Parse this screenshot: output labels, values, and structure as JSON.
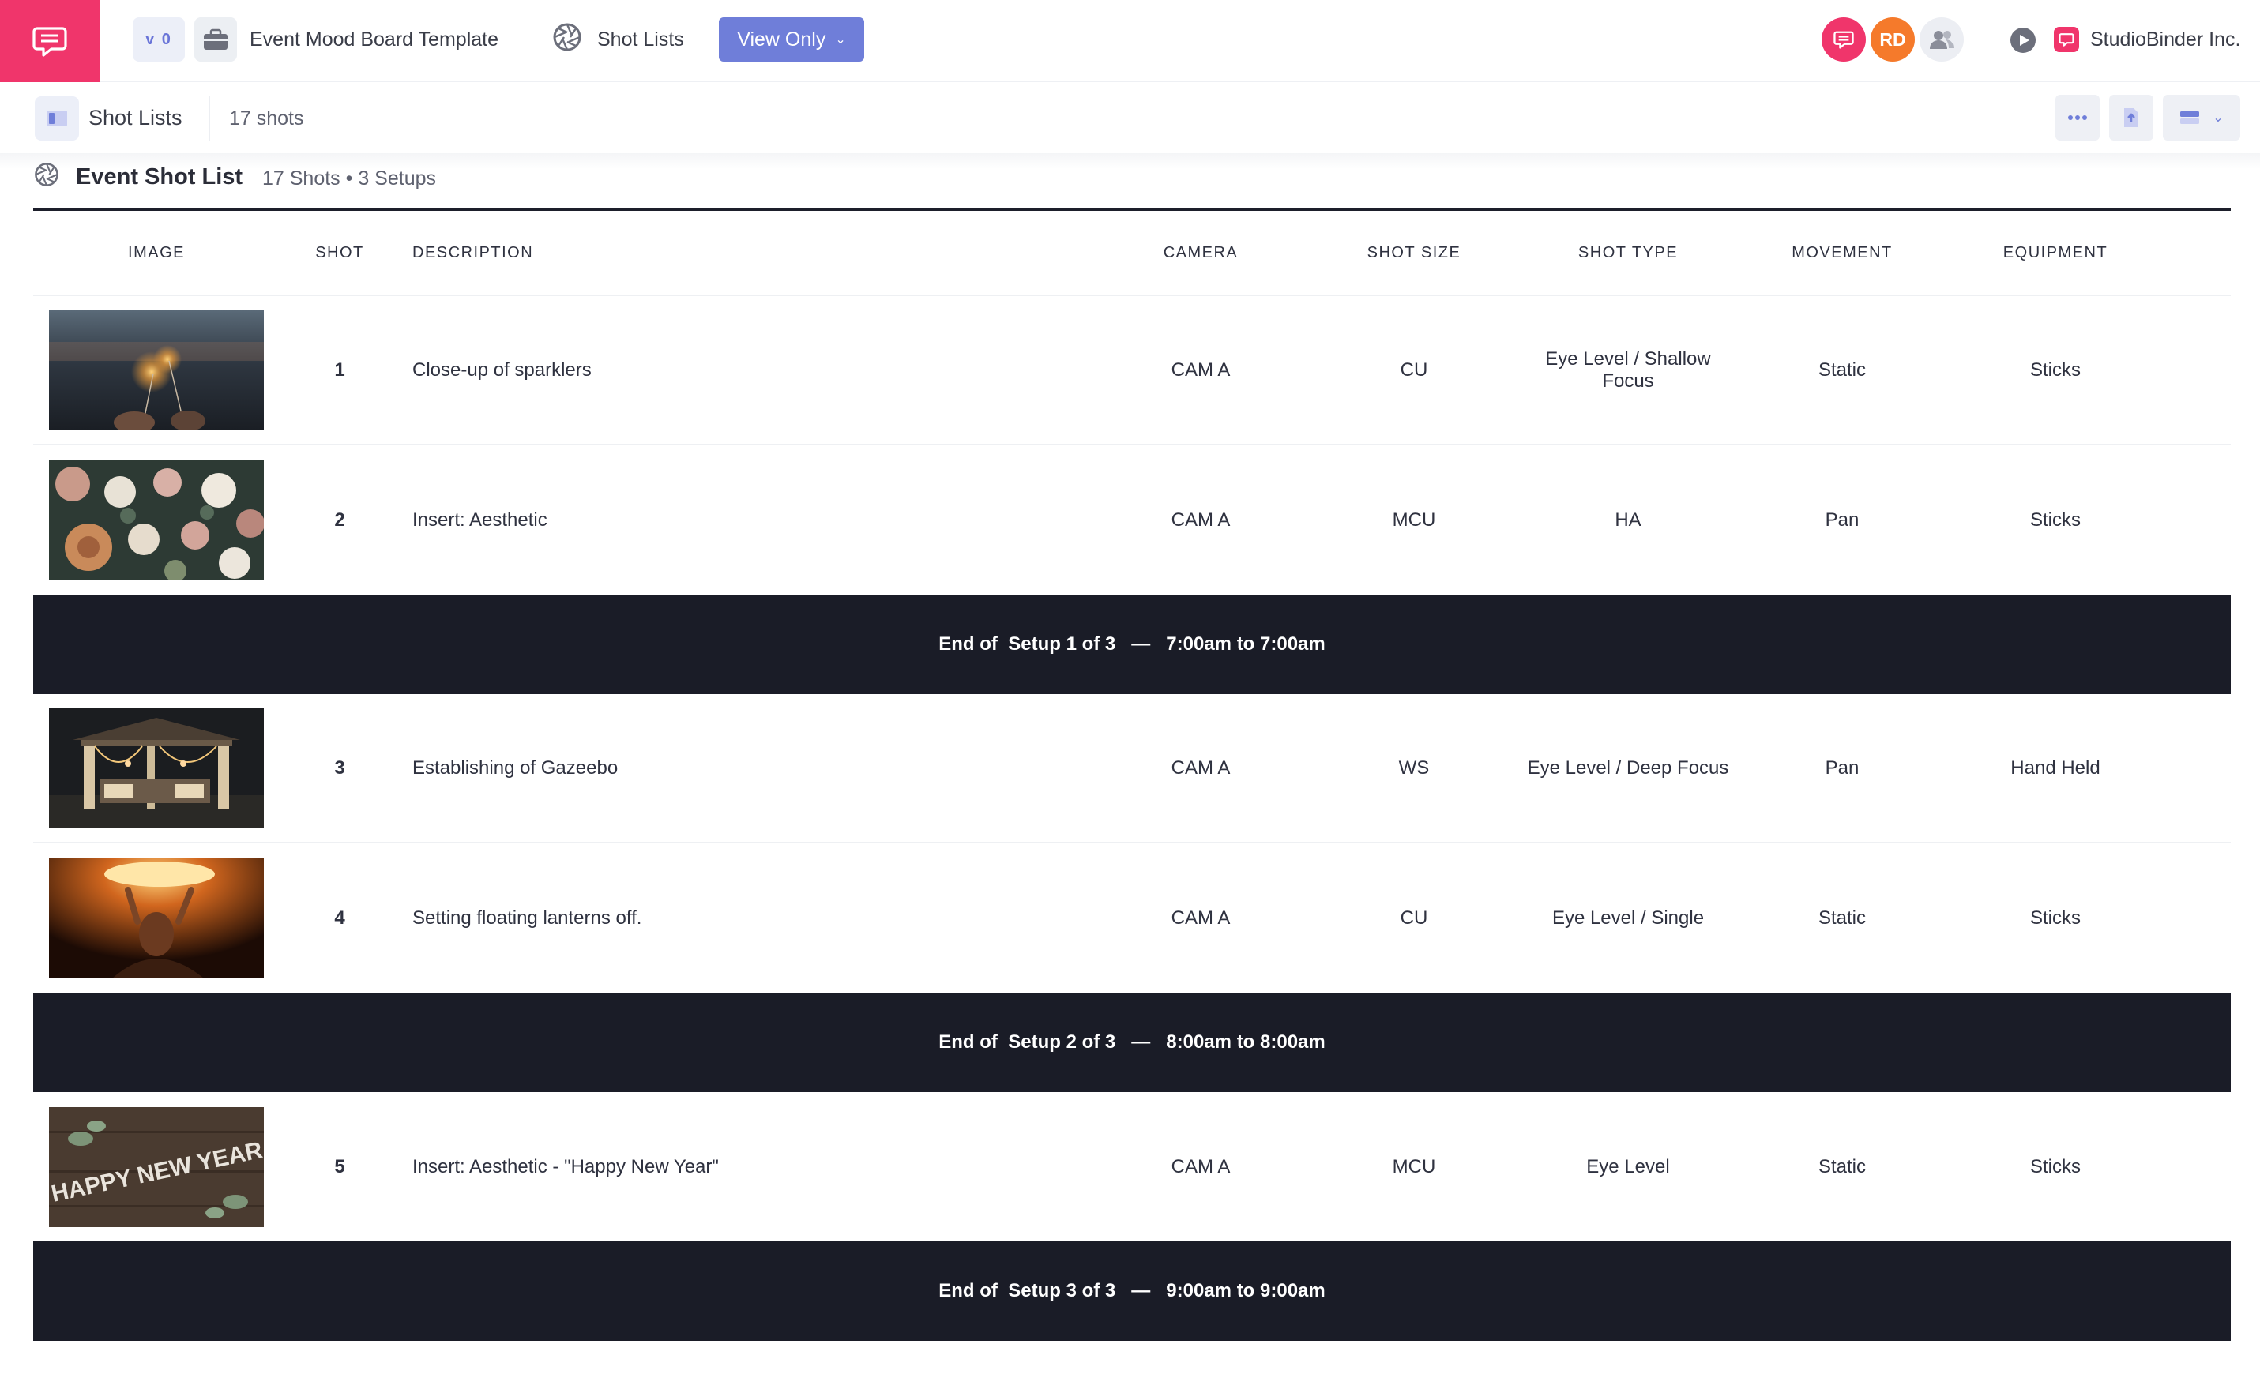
{
  "header": {
    "version": "v 0",
    "project_title": "Event Mood Board Template",
    "nav_label": "Shot Lists",
    "view_mode": "View Only",
    "avatars": [
      {
        "initials": ""
      },
      {
        "initials": "RD"
      },
      {
        "initials": ""
      }
    ],
    "company": "StudioBinder Inc."
  },
  "subbar": {
    "title": "Shot Lists",
    "count": "17 shots"
  },
  "shot_list": {
    "title": "Event Shot List",
    "meta": "17 Shots • 3 Setups",
    "columns": [
      "Image",
      "Shot",
      "Description",
      "Camera",
      "Shot Size",
      "Shot Type",
      "Movement",
      "Equipment"
    ],
    "rows": [
      {
        "shot": "1",
        "description": "Close-up of sparklers",
        "camera": "CAM A",
        "size": "CU",
        "type": "Eye Level / Shallow Focus",
        "movement": "Static",
        "equipment": "Sticks"
      },
      {
        "shot": "2",
        "description": "Insert: Aesthetic",
        "camera": "CAM A",
        "size": "MCU",
        "type": "HA",
        "movement": "Pan",
        "equipment": "Sticks"
      },
      {
        "shot": "3",
        "description": "Establishing of Gazeebo",
        "camera": "CAM A",
        "size": "WS",
        "type": "Eye Level / Deep Focus",
        "movement": "Pan",
        "equipment": "Hand Held"
      },
      {
        "shot": "4",
        "description": "Setting floating lanterns off.",
        "camera": "CAM A",
        "size": "CU",
        "type": "Eye Level / Single",
        "movement": "Static",
        "equipment": "Sticks"
      },
      {
        "shot": "5",
        "description": "Insert: Aesthetic - \"Happy New Year\"",
        "camera": "CAM A",
        "size": "MCU",
        "type": "Eye Level",
        "movement": "Static",
        "equipment": "Sticks"
      }
    ],
    "setups": [
      {
        "label": "End of  Setup 1 of 3",
        "sep": "—",
        "time": "7:00am to 7:00am"
      },
      {
        "label": "End of  Setup 2 of 3",
        "sep": "—",
        "time": "8:00am to 8:00am"
      },
      {
        "label": "End of  Setup 3 of 3",
        "sep": "—",
        "time": "9:00am to 9:00am"
      }
    ],
    "thumb_text": "HAPPY NEW YEAR"
  },
  "colors": {
    "brand": "#f0356b",
    "accent": "#6f7ed9",
    "setup_bar": "#1a1c27",
    "avatar_orange": "#f57a2b"
  },
  "icons": [
    "chat-icon",
    "briefcase-icon",
    "aperture-icon",
    "chevron-down-icon",
    "users-icon",
    "play-icon",
    "layout-icon",
    "more-icon",
    "export-icon",
    "view-icon"
  ]
}
